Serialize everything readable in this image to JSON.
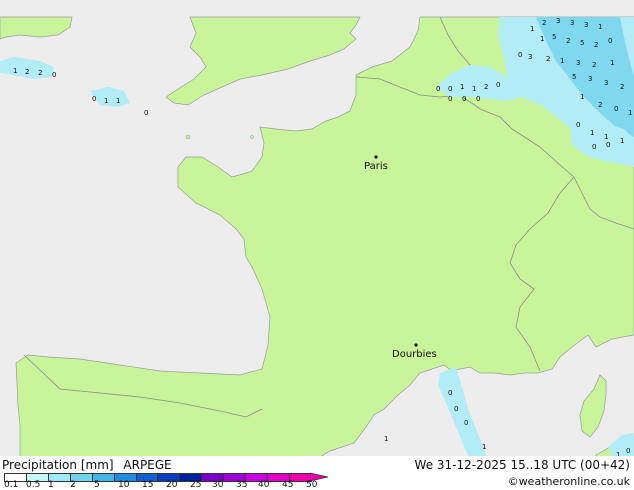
{
  "map": {
    "colors": {
      "sea": "#ededed",
      "land": "#c8f59a",
      "border": "#8a8a8a",
      "coast": "#9a9a9a",
      "precip_light": "#b2ecf6",
      "precip_mid": "#7fd8ee"
    },
    "cities": [
      {
        "name": "Paris"
      },
      {
        "name": "Dourbies"
      }
    ]
  },
  "footer": {
    "title": "Precipitation [mm]",
    "model": "ARPEGE",
    "datetime": "We 31-12-2025 15..18 UTC (00+42)",
    "credit": "©weatheronline.co.uk",
    "scale_labels": [
      "0.1",
      "0.5",
      "1",
      "2",
      "5",
      "10",
      "15",
      "20",
      "25",
      "30",
      "35",
      "40",
      "45",
      "50"
    ],
    "scale_colors": [
      "#ffffff",
      "#c8f5fa",
      "#a0e8f5",
      "#6fd3ee",
      "#40b8e6",
      "#1f8ee0",
      "#1060d0",
      "#0a3cc0",
      "#0020a0",
      "#7a00c8",
      "#a000d8",
      "#c800e0",
      "#e000c8",
      "#f000a8"
    ]
  }
}
